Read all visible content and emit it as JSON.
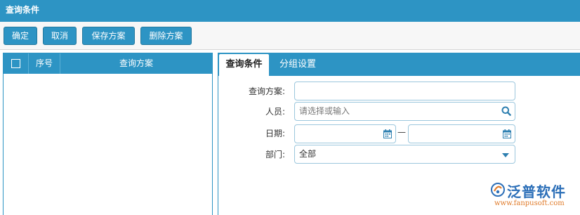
{
  "window": {
    "title": "查询条件"
  },
  "toolbar": {
    "confirm_label": "确定",
    "cancel_label": "取消",
    "save_scheme_label": "保存方案",
    "delete_scheme_label": "删除方案"
  },
  "grid": {
    "columns": [
      "序号",
      "查询方案"
    ],
    "rows": []
  },
  "tabs": [
    {
      "label": "查询条件",
      "active": true
    },
    {
      "label": "分组设置",
      "active": false
    }
  ],
  "form": {
    "scheme_label": "查询方案:",
    "scheme_value": "",
    "person_label": "人员:",
    "person_placeholder": "请选择或输入",
    "date_label": "日期:",
    "date_start_value": "",
    "date_end_value": "",
    "date_separator": "—",
    "dept_label": "部门:",
    "dept_value": "全部"
  },
  "icons": {
    "search": "search-icon",
    "calendar": "calendar-icon",
    "dropdown": "chevron-down-icon"
  },
  "brand": {
    "logo_text": "泛普软件",
    "logo_url": "www.fanpusoft.com"
  },
  "colors": {
    "accent": "#2d94c4",
    "field_border": "#9cc7dd",
    "brand_blue": "#2c6fb8",
    "brand_orange": "#e07b2a"
  }
}
